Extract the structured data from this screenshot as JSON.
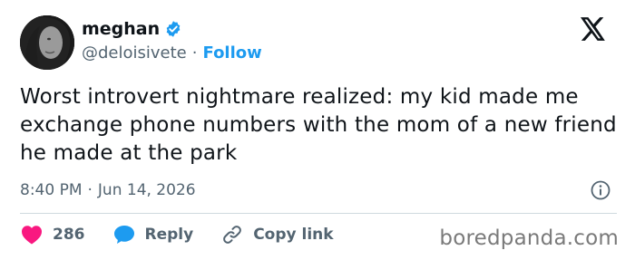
{
  "author": {
    "display_name": "meghan",
    "handle": "@deloisivete",
    "separator": "·",
    "follow_label": "Follow"
  },
  "tweet": {
    "text": "Worst introvert nightmare realized: my kid made me exchange phone numbers with the mom of a new friend he made at the park",
    "time": "8:40 PM",
    "separator": "·",
    "date": "Jun 14, 2026"
  },
  "actions": {
    "like_count": "286",
    "reply_label": "Reply",
    "copy_label": "Copy link"
  },
  "watermark": "boredpanda.com",
  "icons": {
    "verified": "verified-badge-icon",
    "x_logo": "x-logo-icon",
    "info": "info-icon",
    "like": "heart-icon",
    "reply": "speech-bubble-icon",
    "copy": "link-icon"
  },
  "colors": {
    "accent": "#1d9bf0",
    "heart": "#f91880",
    "muted": "#536471",
    "text": "#0f1419"
  }
}
